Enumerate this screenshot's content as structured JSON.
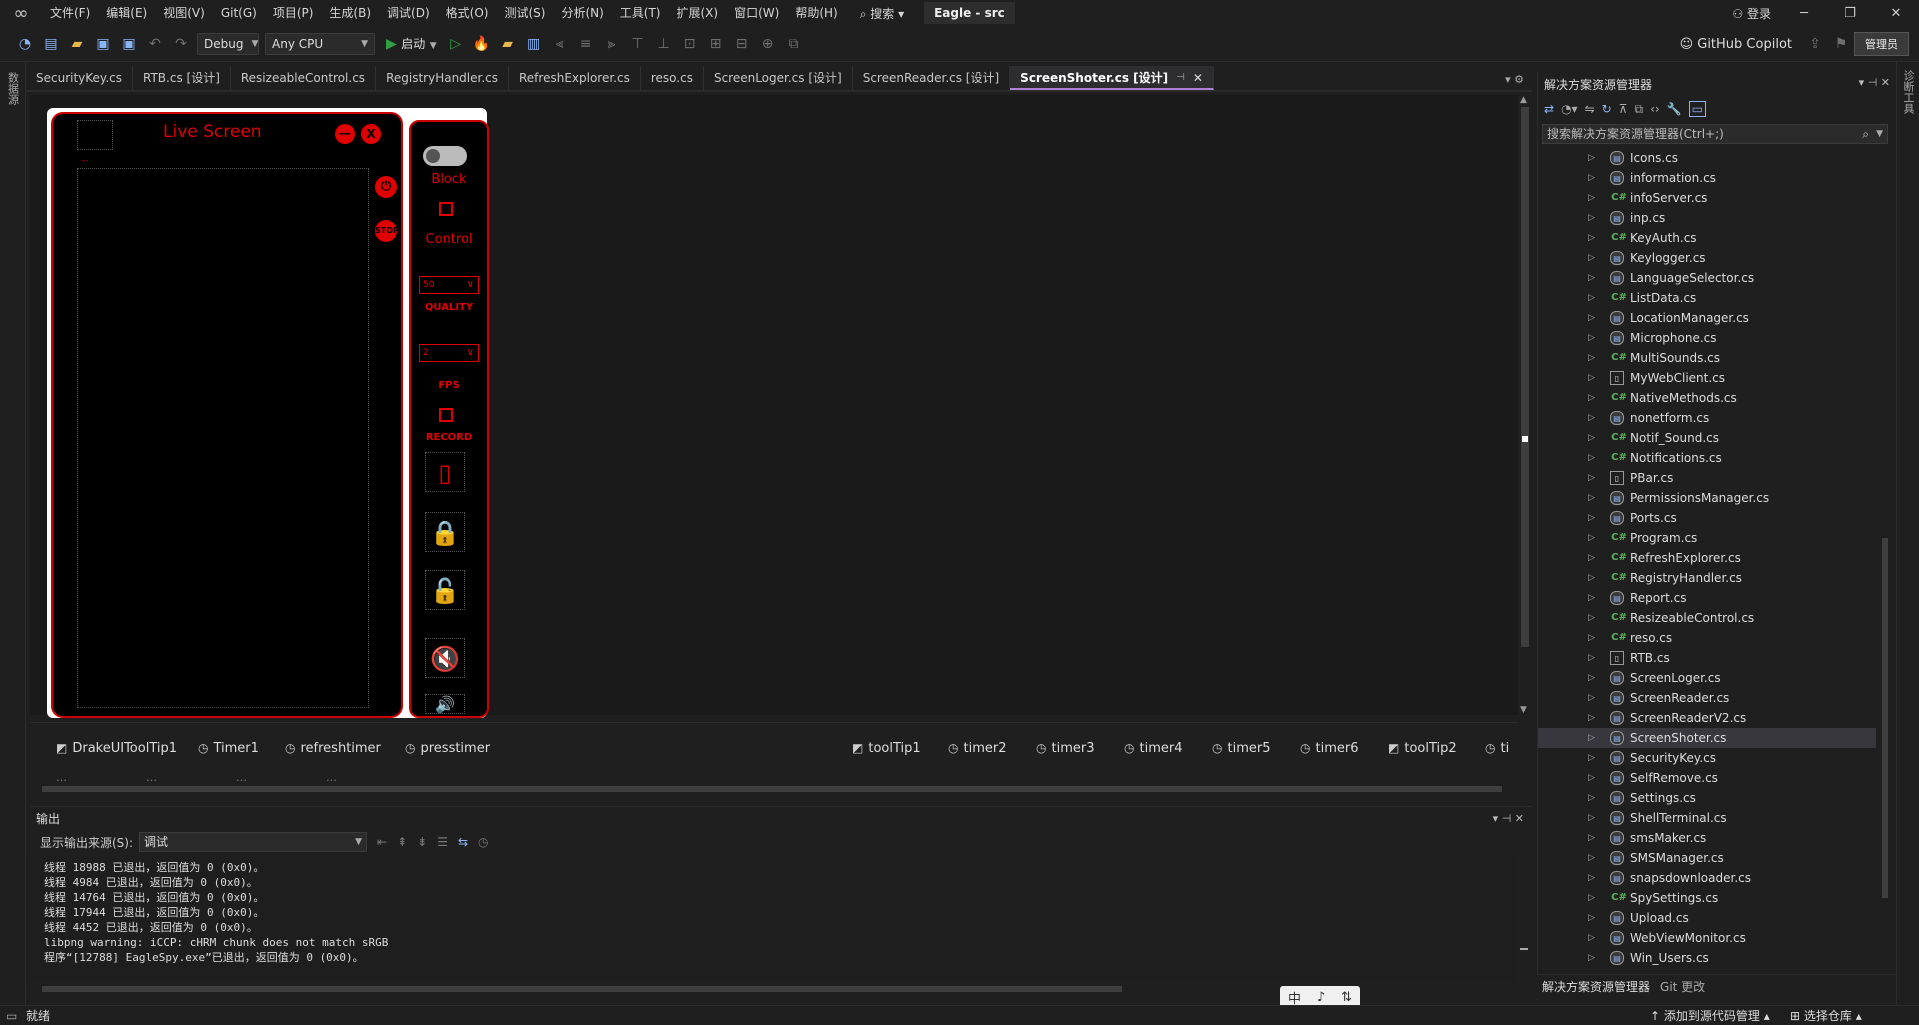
{
  "menu": {
    "logo": "vs-logo-icon",
    "items": [
      "文件(F)",
      "编辑(E)",
      "视图(V)",
      "Git(G)",
      "项目(P)",
      "生成(B)",
      "调试(D)",
      "格式(O)",
      "测试(S)",
      "分析(N)",
      "工具(T)",
      "扩展(X)",
      "窗口(W)",
      "帮助(H)"
    ],
    "search": "搜索",
    "title": "Eagle - src",
    "login": "登录"
  },
  "toolbar": {
    "config": "Debug",
    "platform": "Any CPU",
    "start": "启动",
    "copilot": "GitHub Copilot",
    "admin": "管理员"
  },
  "left_strip": "数据源",
  "right_strip": "诊断工具",
  "tabs": [
    {
      "label": "SecurityKey.cs"
    },
    {
      "label": "RTB.cs [设计]"
    },
    {
      "label": "ResizeableControl.cs"
    },
    {
      "label": "RegistryHandler.cs"
    },
    {
      "label": "RefreshExplorer.cs"
    },
    {
      "label": "reso.cs"
    },
    {
      "label": "ScreenLoger.cs [设计]"
    },
    {
      "label": "ScreenReader.cs [设计]"
    },
    {
      "label": "ScreenShoter.cs [设计]"
    }
  ],
  "form": {
    "title": "Live Screen",
    "tiny": "...",
    "minimize": "—",
    "close": "X",
    "stop": "STOP",
    "block_label": "Block",
    "control_label": "Control",
    "quality_value": "50",
    "quality_label": "QUALITY",
    "fps_value": "2",
    "fps_label": "FPS",
    "record_label": "RECORD"
  },
  "tray": {
    "row1": [
      "DrakeUIToolTip1",
      "Timer1",
      "refreshtimer",
      "presstimer",
      "toolTip1",
      "timer2",
      "timer3",
      "timer4",
      "timer5",
      "timer6",
      "toolTip2",
      "ti"
    ],
    "row2": [
      "…",
      "…",
      "…",
      "…"
    ]
  },
  "output": {
    "title": "输出",
    "source_label": "显示输出来源(S):",
    "source_value": "调试",
    "lines": [
      "线程 18988 已退出，返回值为 0 (0x0)。",
      "线程 4984 已退出，返回值为 0 (0x0)。",
      "线程 14764 已退出，返回值为 0 (0x0)。",
      "线程 17944 已退出，返回值为 0 (0x0)。",
      "线程 4452 已退出，返回值为 0 (0x0)。",
      "libpng warning: iCCP: cHRM chunk does not match sRGB",
      "程序“[12788] EagleSpy.exe”已退出，返回值为 0 (0x0)。"
    ]
  },
  "solution_explorer": {
    "title": "解决方案资源管理器",
    "search_placeholder": "搜索解决方案资源管理器(Ctrl+;)",
    "files": [
      {
        "name": "Icons.cs",
        "icon": "form"
      },
      {
        "name": "information.cs",
        "icon": "form"
      },
      {
        "name": "infoServer.cs",
        "icon": "cs"
      },
      {
        "name": "inp.cs",
        "icon": "form"
      },
      {
        "name": "KeyAuth.cs",
        "icon": "cs"
      },
      {
        "name": "Keylogger.cs",
        "icon": "form"
      },
      {
        "name": "LanguageSelector.cs",
        "icon": "form"
      },
      {
        "name": "ListData.cs",
        "icon": "cs"
      },
      {
        "name": "LocationManager.cs",
        "icon": "form"
      },
      {
        "name": "Microphone.cs",
        "icon": "form"
      },
      {
        "name": "MultiSounds.cs",
        "icon": "cs"
      },
      {
        "name": "MyWebClient.cs",
        "icon": "file"
      },
      {
        "name": "NativeMethods.cs",
        "icon": "cs"
      },
      {
        "name": "nonetform.cs",
        "icon": "form"
      },
      {
        "name": "Notif_Sound.cs",
        "icon": "cs"
      },
      {
        "name": "Notifications.cs",
        "icon": "cs"
      },
      {
        "name": "PBar.cs",
        "icon": "file"
      },
      {
        "name": "PermissionsManager.cs",
        "icon": "form"
      },
      {
        "name": "Ports.cs",
        "icon": "form"
      },
      {
        "name": "Program.cs",
        "icon": "cs"
      },
      {
        "name": "RefreshExplorer.cs",
        "icon": "cs"
      },
      {
        "name": "RegistryHandler.cs",
        "icon": "cs"
      },
      {
        "name": "Report.cs",
        "icon": "form"
      },
      {
        "name": "ResizeableControl.cs",
        "icon": "cs"
      },
      {
        "name": "reso.cs",
        "icon": "cs"
      },
      {
        "name": "RTB.cs",
        "icon": "file"
      },
      {
        "name": "ScreenLoger.cs",
        "icon": "form"
      },
      {
        "name": "ScreenReader.cs",
        "icon": "form"
      },
      {
        "name": "ScreenReaderV2.cs",
        "icon": "form"
      },
      {
        "name": "ScreenShoter.cs",
        "icon": "form"
      },
      {
        "name": "SecurityKey.cs",
        "icon": "form"
      },
      {
        "name": "SelfRemove.cs",
        "icon": "form"
      },
      {
        "name": "Settings.cs",
        "icon": "form"
      },
      {
        "name": "ShellTerminal.cs",
        "icon": "form"
      },
      {
        "name": "smsMaker.cs",
        "icon": "form"
      },
      {
        "name": "SMSManager.cs",
        "icon": "form"
      },
      {
        "name": "snapsdownloader.cs",
        "icon": "form"
      },
      {
        "name": "SpySettings.cs",
        "icon": "cs"
      },
      {
        "name": "Upload.cs",
        "icon": "form"
      },
      {
        "name": "WebViewMonitor.cs",
        "icon": "form"
      },
      {
        "name": "Win_Users.cs",
        "icon": "form"
      }
    ],
    "selected": "ScreenShoter.cs",
    "bottom_tabs": [
      "解决方案资源管理器",
      "Git 更改"
    ]
  },
  "ime": [
    "中",
    "♪",
    "⇅"
  ],
  "status": {
    "left": "就绪",
    "add_source": "添加到源代码管理",
    "select_repo": "选择仓库"
  }
}
